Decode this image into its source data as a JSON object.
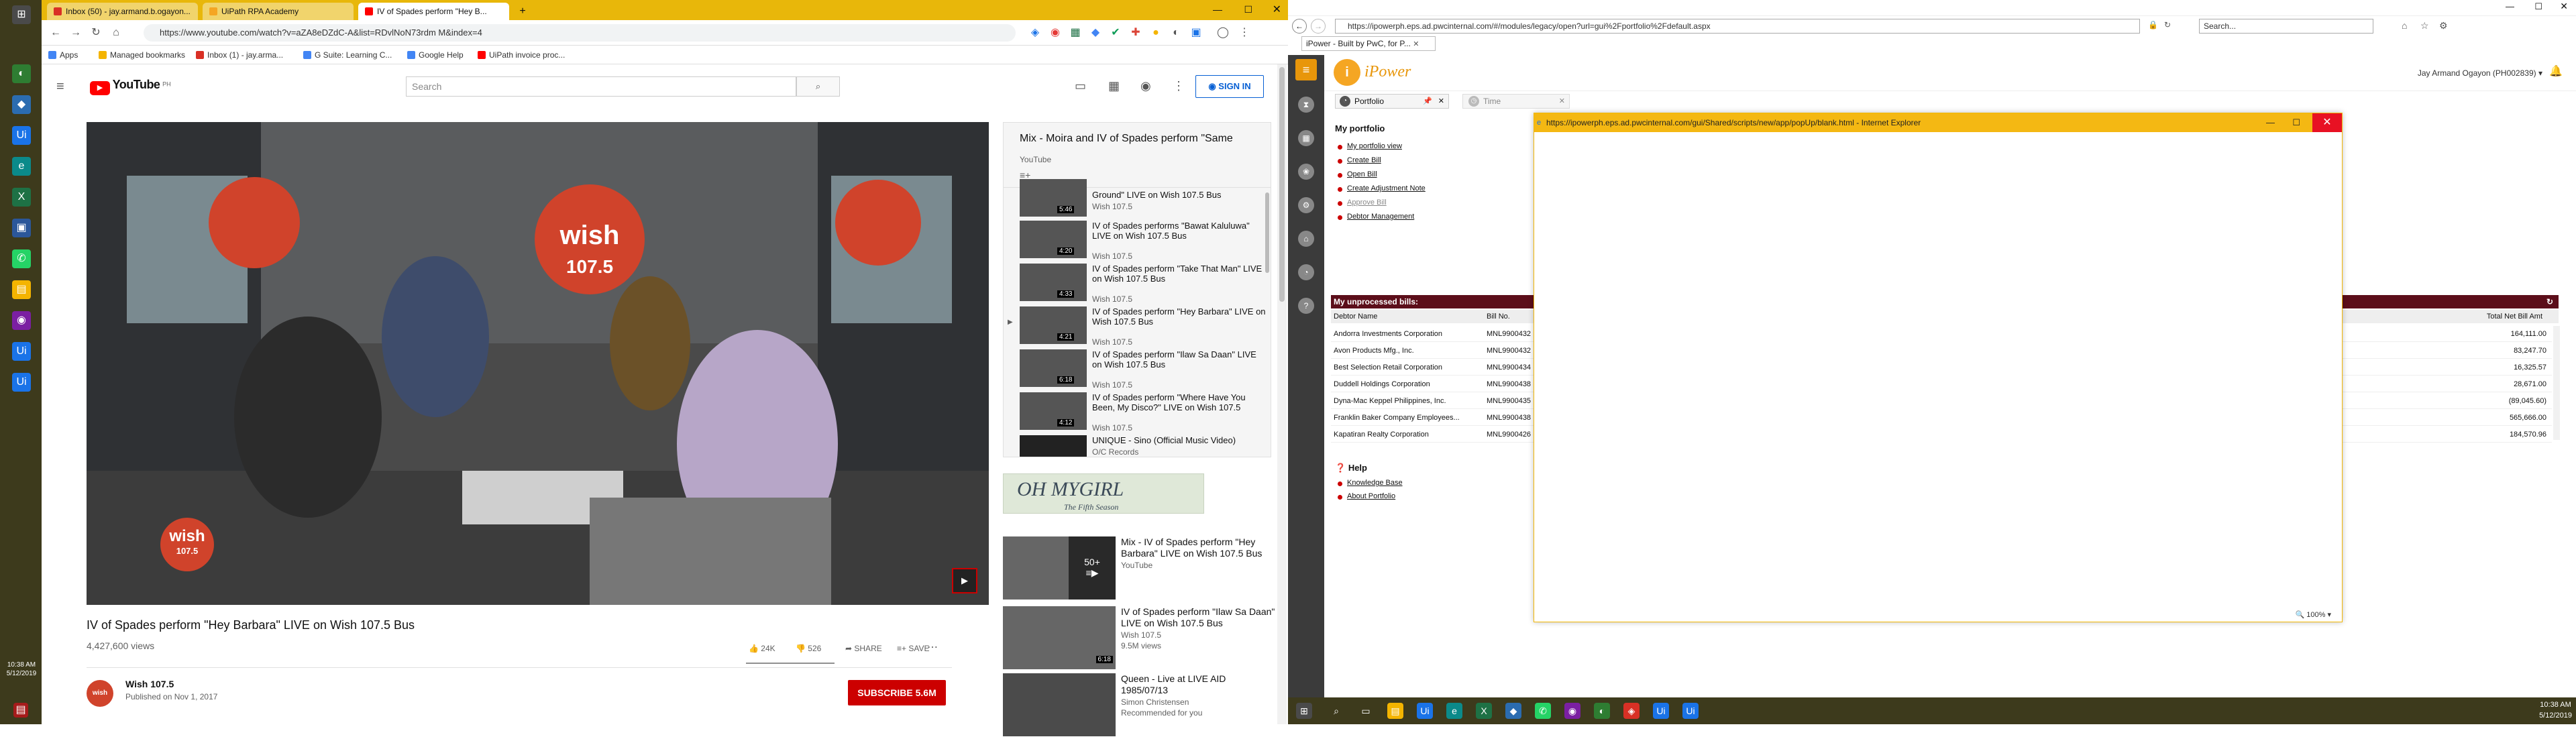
{
  "left_taskbar": {
    "time": "10:38 AM",
    "date": "5/12/2019"
  },
  "chrome": {
    "tabs": [
      {
        "label": "Inbox (50) - jay.armand.b.ogayon...",
        "color": "#d93025"
      },
      {
        "label": "UiPath RPA Academy",
        "color": "#f5a623"
      },
      {
        "label": "IV of Spades perform \"Hey B...",
        "color": "#ff0000"
      }
    ],
    "new_tab": "+",
    "url": "https://www.youtube.com/watch?v=aZA8eDZdC-A&list=RDvlNoN73rdm M&index=4",
    "bookmarks": [
      "Apps",
      "Managed bookmarks",
      "Inbox (1) - jay.arma...",
      "G Suite: Learning C...",
      "Google Help",
      "UiPath invoice proc..."
    ]
  },
  "youtube": {
    "logo": "YouTube",
    "logo_sup": "PH",
    "search_placeholder": "Search",
    "sign_in": "SIGN IN",
    "video_title": "IV of Spades perform \"Hey Barbara\" LIVE on Wish 107.5 Bus",
    "views": "4,427,600 views",
    "likes": "24K",
    "dislikes": "526",
    "share": "SHARE",
    "save": "SAVE",
    "channel_name": "Wish 107.5",
    "published": "Published on Nov 1, 2017",
    "subscribe": "SUBSCRIBE 5.6M",
    "player_wish_logo": "wish",
    "player_wish_sub": "107.5",
    "mix": {
      "title": "Mix - Moira and IV of Spades perform \"Same",
      "subtitle": "YouTube",
      "items": [
        {
          "title": "Ground\" LIVE on Wish 107.5 Bus",
          "channel": "Wish 107.5",
          "duration": "5:46"
        },
        {
          "title": "IV of Spades performs \"Bawat Kaluluwa\" LIVE on Wish 107.5 Bus",
          "channel": "Wish 107.5",
          "duration": "4:20"
        },
        {
          "title": "IV of Spades perform \"Take That Man\" LIVE on Wish 107.5 Bus",
          "channel": "Wish 107.5",
          "duration": "4:33"
        },
        {
          "title": "IV of Spades perform \"Hey Barbara\" LIVE on Wish 107.5 Bus",
          "channel": "Wish 107.5",
          "duration": "4:21"
        },
        {
          "title": "IV of Spades perform \"Ilaw Sa Daan\" LIVE on Wish 107.5 Bus",
          "channel": "Wish 107.5",
          "duration": "6:18"
        },
        {
          "title": "IV of Spades perform \"Where Have You Been, My Disco?\" LIVE on Wish 107.5",
          "channel": "Wish 107.5",
          "duration": "4:12"
        },
        {
          "title": "UNIQUE - Sino (Official Music Video)",
          "channel": "O/C Records",
          "duration": ""
        }
      ]
    },
    "ad": {
      "line1": "OH MYGIRL",
      "line2": "The Fifth Season"
    },
    "recommended": [
      {
        "title": "Mix - IV of Spades perform \"Hey Barbara\" LIVE on Wish 107.5 Bus",
        "sub1": "YouTube",
        "sub2": "",
        "badge": "50+"
      },
      {
        "title": "IV of Spades perform \"Ilaw Sa Daan\" LIVE on Wish 107.5 Bus",
        "sub1": "Wish 107.5",
        "sub2": "9.5M views",
        "badge": "6:18"
      },
      {
        "title": "Queen - Live at LIVE AID 1985/07/13",
        "sub1": "Simon Christensen",
        "sub2": "Recommended for you",
        "badge": ""
      }
    ]
  },
  "ie": {
    "url": "https://ipowerph.eps.ad.pwcinternal.com/#/modules/legacy/open?url=gui%2Fportfolio%2Fdefault.aspx",
    "search": "Search...",
    "tab_label": "iPower - Built by PwC, for P..."
  },
  "ipower": {
    "logo": "iPower",
    "user": "Jay Armand Ogayon (PH002839)",
    "tab_portfolio": "Portfolio",
    "tab_time": "Time",
    "my_portfolio": "My portfolio",
    "links": [
      "My portfolio view",
      "Create Bill",
      "Open Bill",
      "Create Adjustment Note",
      "Approve Bill",
      "Debtor Management"
    ],
    "unprocessed_title": "My unprocessed bills:",
    "col_debtor": "Debtor Name",
    "col_bill": "Bill No.",
    "col_total": "Total Net Bill Amt",
    "bills": [
      {
        "debtor": "Andorra Investments Corporation",
        "bill": "MNL9900432",
        "amt": "164,111.00"
      },
      {
        "debtor": "Avon Products Mfg., Inc.",
        "bill": "MNL9900432",
        "amt": "83,247.70"
      },
      {
        "debtor": "Best Selection Retail Corporation",
        "bill": "MNL9900434",
        "amt": "16,325.57"
      },
      {
        "debtor": "Duddell Holdings Corporation",
        "bill": "MNL9900438",
        "amt": "28,671.00"
      },
      {
        "debtor": "Dyna-Mac Keppel Philippines, Inc.",
        "bill": "MNL9900435",
        "amt": "(89,045.60)"
      },
      {
        "debtor": "Franklin Baker Company Employees...",
        "bill": "MNL9900438",
        "amt": "565,666.00"
      },
      {
        "debtor": "Kapatiran Realty Corporation",
        "bill": "MNL9900426",
        "amt": "184,570.96"
      }
    ],
    "help_title": "Help",
    "help_links": [
      "Knowledge Base",
      "About Portfolio"
    ],
    "popup_title": "https://ipowerph.eps.ad.pwcinternal.com/gui/Shared/scripts/new/app/popUp/blank.html - Internet Explorer",
    "zoom": "100%"
  },
  "right_taskbar": {
    "time": "10:38 AM",
    "date": "5/12/2019"
  }
}
